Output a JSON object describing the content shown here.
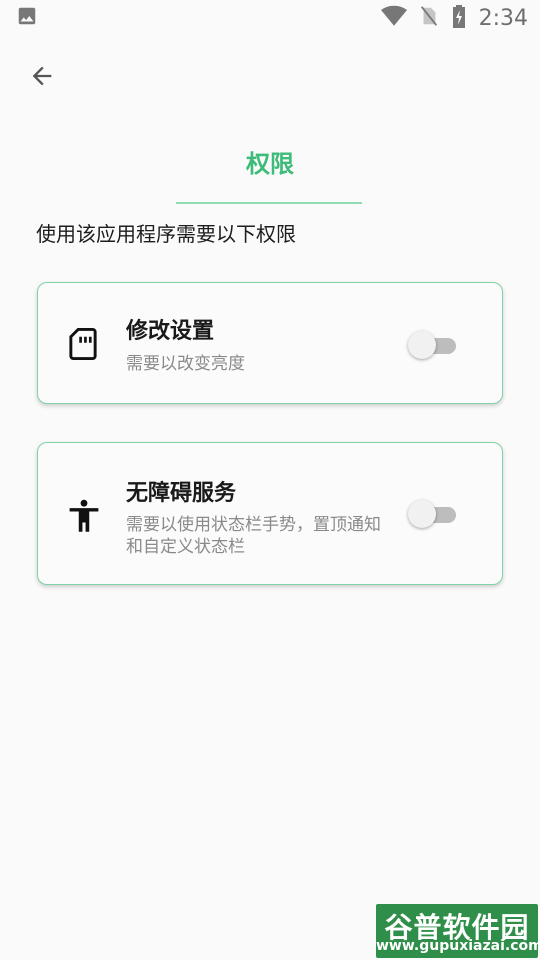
{
  "status_bar": {
    "time": "2:34",
    "icons": [
      "image-icon",
      "wifi-icon",
      "no-sim-icon",
      "battery-charging-icon"
    ]
  },
  "header": {
    "back_icon": "arrow-left-icon",
    "title": "权限"
  },
  "intro": "使用该应用程序需要以下权限",
  "permissions": [
    {
      "icon": "sd-card-icon",
      "title": "修改设置",
      "description": "需要以改变亮度",
      "enabled": false
    },
    {
      "icon": "accessibility-icon",
      "title": "无障碍服务",
      "description": "需要以使用状态栏手势，置顶通知和自定义状态栏",
      "enabled": false
    }
  ],
  "watermark": {
    "name": "谷普软件园",
    "url": "www.gupuxiazai.com"
  },
  "colors": {
    "accent": "#3dbb78",
    "card_border": "#7fd3a4",
    "background": "#fafafa"
  }
}
